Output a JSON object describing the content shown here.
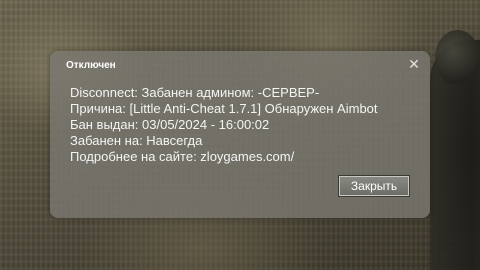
{
  "dialog": {
    "title": "Отключен",
    "close_icon_glyph": "✕",
    "lines": [
      "Disconnect: Забанен админом: -СЕРВЕР-",
      "Причина: [Little Anti-Cheat 1.7.1] Обнаружен Aimbot",
      "Бан выдан: 03/05/2024 - 16:00:02",
      "Забанен на: Навсегда",
      "Подробнее на сайте: zloygames.com/"
    ],
    "close_button_label": "Закрыть"
  }
}
